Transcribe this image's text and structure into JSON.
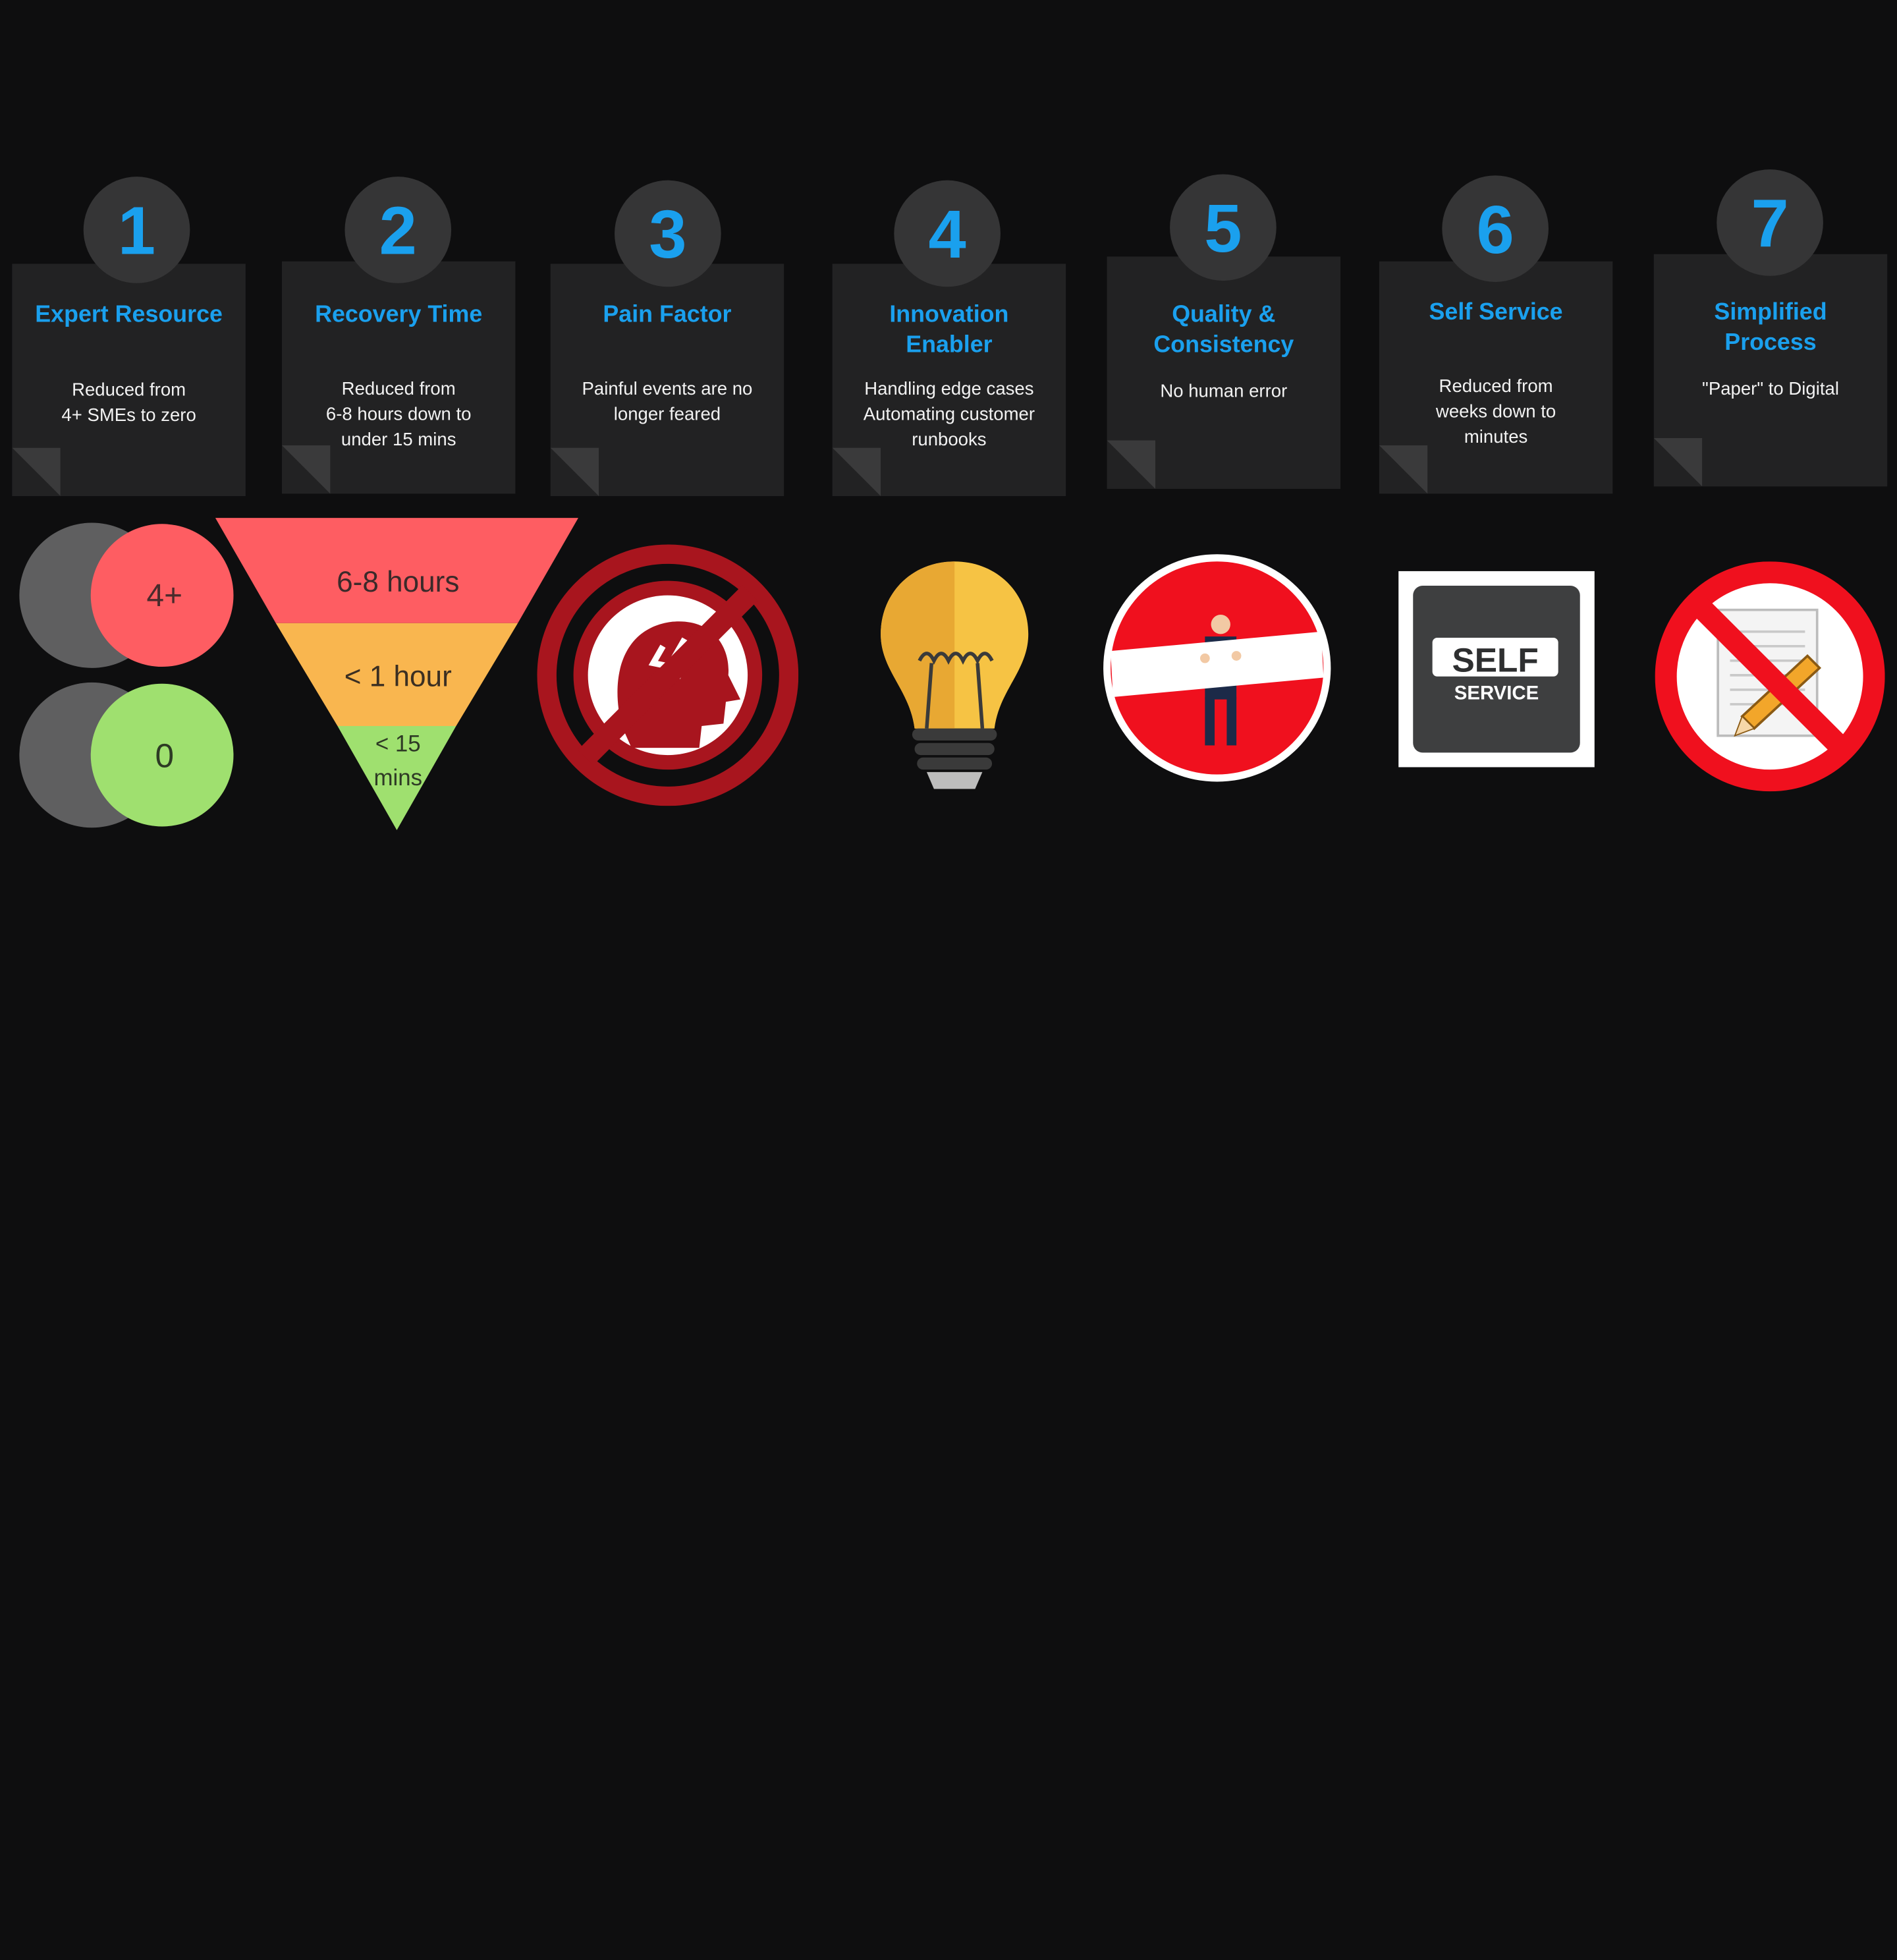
{
  "steps": [
    {
      "number": "1",
      "title": "Expert Resource",
      "body": "Reduced from\n4+ SMEs to zero"
    },
    {
      "number": "2",
      "title": "Recovery Time",
      "body": "Reduced from\n6-8 hours down to\nunder 15 mins"
    },
    {
      "number": "3",
      "title": "Pain Factor",
      "body": "Painful events are no\nlonger feared"
    },
    {
      "number": "4",
      "title": "Innovation\nEnabler",
      "body": "Handling edge cases\nAutomating customer\nrunbooks"
    },
    {
      "number": "5",
      "title": "Quality &\nConsistency",
      "body": "No human error"
    },
    {
      "number": "6",
      "title": "Self Service",
      "body": "Reduced from\nweeks down to\nminutes"
    },
    {
      "number": "7",
      "title": "Simplified\nProcess",
      "body": "\"Paper\" to Digital"
    }
  ],
  "sme_circles": {
    "before": "4+",
    "after": "0"
  },
  "funnel": {
    "top": "6-8 hours",
    "middle": "< 1 hour",
    "bottom_line1": "< 15",
    "bottom_line2": "mins"
  },
  "self_service_sign": {
    "line1": "SELF",
    "line2": "SERVICE"
  },
  "colors": {
    "accent": "#1aa0ee",
    "card": "#222223",
    "badge": "#353536",
    "red": "#fe5d62",
    "orange": "#f9b64f",
    "green": "#9fe06f",
    "prohibit": "#a8151e"
  }
}
